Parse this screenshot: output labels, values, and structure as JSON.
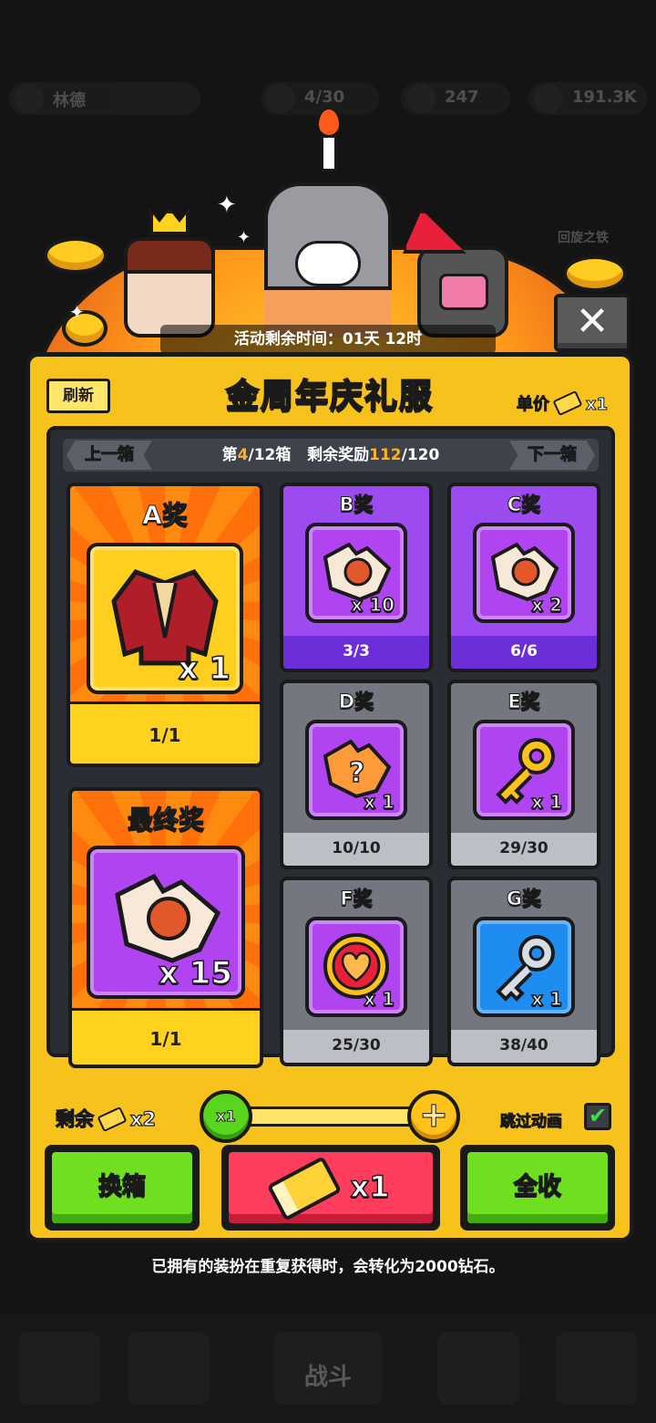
{
  "background": {
    "player_name": "林德",
    "resources": [
      "4/30",
      "247",
      "191.3K"
    ],
    "side_label": "回旋之铁",
    "battle_tab": "战斗"
  },
  "event": {
    "time_remaining": "活动剩余时间：01天 12时"
  },
  "panel": {
    "refresh_label": "刷新",
    "title": "金周年庆礼服",
    "unit_price_label": "单价",
    "unit_price_qty": "x1"
  },
  "nav": {
    "prev_label": "上一箱",
    "next_label": "下一箱",
    "box_prefix": "第",
    "box_current": "4",
    "box_total": "/12箱",
    "reward_prefix": "剩余奖励",
    "reward_remaining": "112",
    "reward_total": "/120"
  },
  "prizes": [
    {
      "label": "A奖",
      "item": "red-jacket-outfit",
      "qty": "x 1",
      "count": "1/1",
      "tier": "orange"
    },
    {
      "label": "B奖",
      "item": "character-puzzle-piece",
      "qty": "x 10",
      "count": "3/3",
      "tier": "purple"
    },
    {
      "label": "C奖",
      "item": "character-puzzle-piece",
      "qty": "x 2",
      "count": "6/6",
      "tier": "purple"
    },
    {
      "label": "D奖",
      "item": "mystery-puzzle-piece",
      "qty": "x 1",
      "count": "10/10",
      "tier": "gray"
    },
    {
      "label": "E奖",
      "item": "gold-key",
      "qty": "x 1",
      "count": "29/30",
      "tier": "gray"
    },
    {
      "label": "F奖",
      "item": "heart-medal",
      "qty": "x 1",
      "count": "25/30",
      "tier": "gray"
    },
    {
      "label": "G奖",
      "item": "silver-key",
      "qty": "x 1",
      "count": "38/40",
      "tier": "gray"
    },
    {
      "label": "最终奖",
      "item": "character-puzzle-piece",
      "qty": "x 15",
      "count": "1/1",
      "tier": "orange"
    }
  ],
  "controls": {
    "remain_label": "剩余",
    "remain_qty": "x2",
    "draw_count_label": "x1",
    "plus_label": "+",
    "skip_anim_label": "跳过动画",
    "skip_anim_checked": true,
    "swap_box_label": "换箱",
    "draw_label": "x1",
    "collect_all_label": "全收"
  },
  "notice": "已拥有的装扮在重复获得时，会转化为2000钻石。",
  "colors": {
    "panel_yellow": "#f7c21b",
    "button_green": "#6fe01f",
    "button_red": "#ff3d5c",
    "prize_purple": "#9b4bf0",
    "prize_gray": "#74777f",
    "highlight": "#ffb020"
  }
}
